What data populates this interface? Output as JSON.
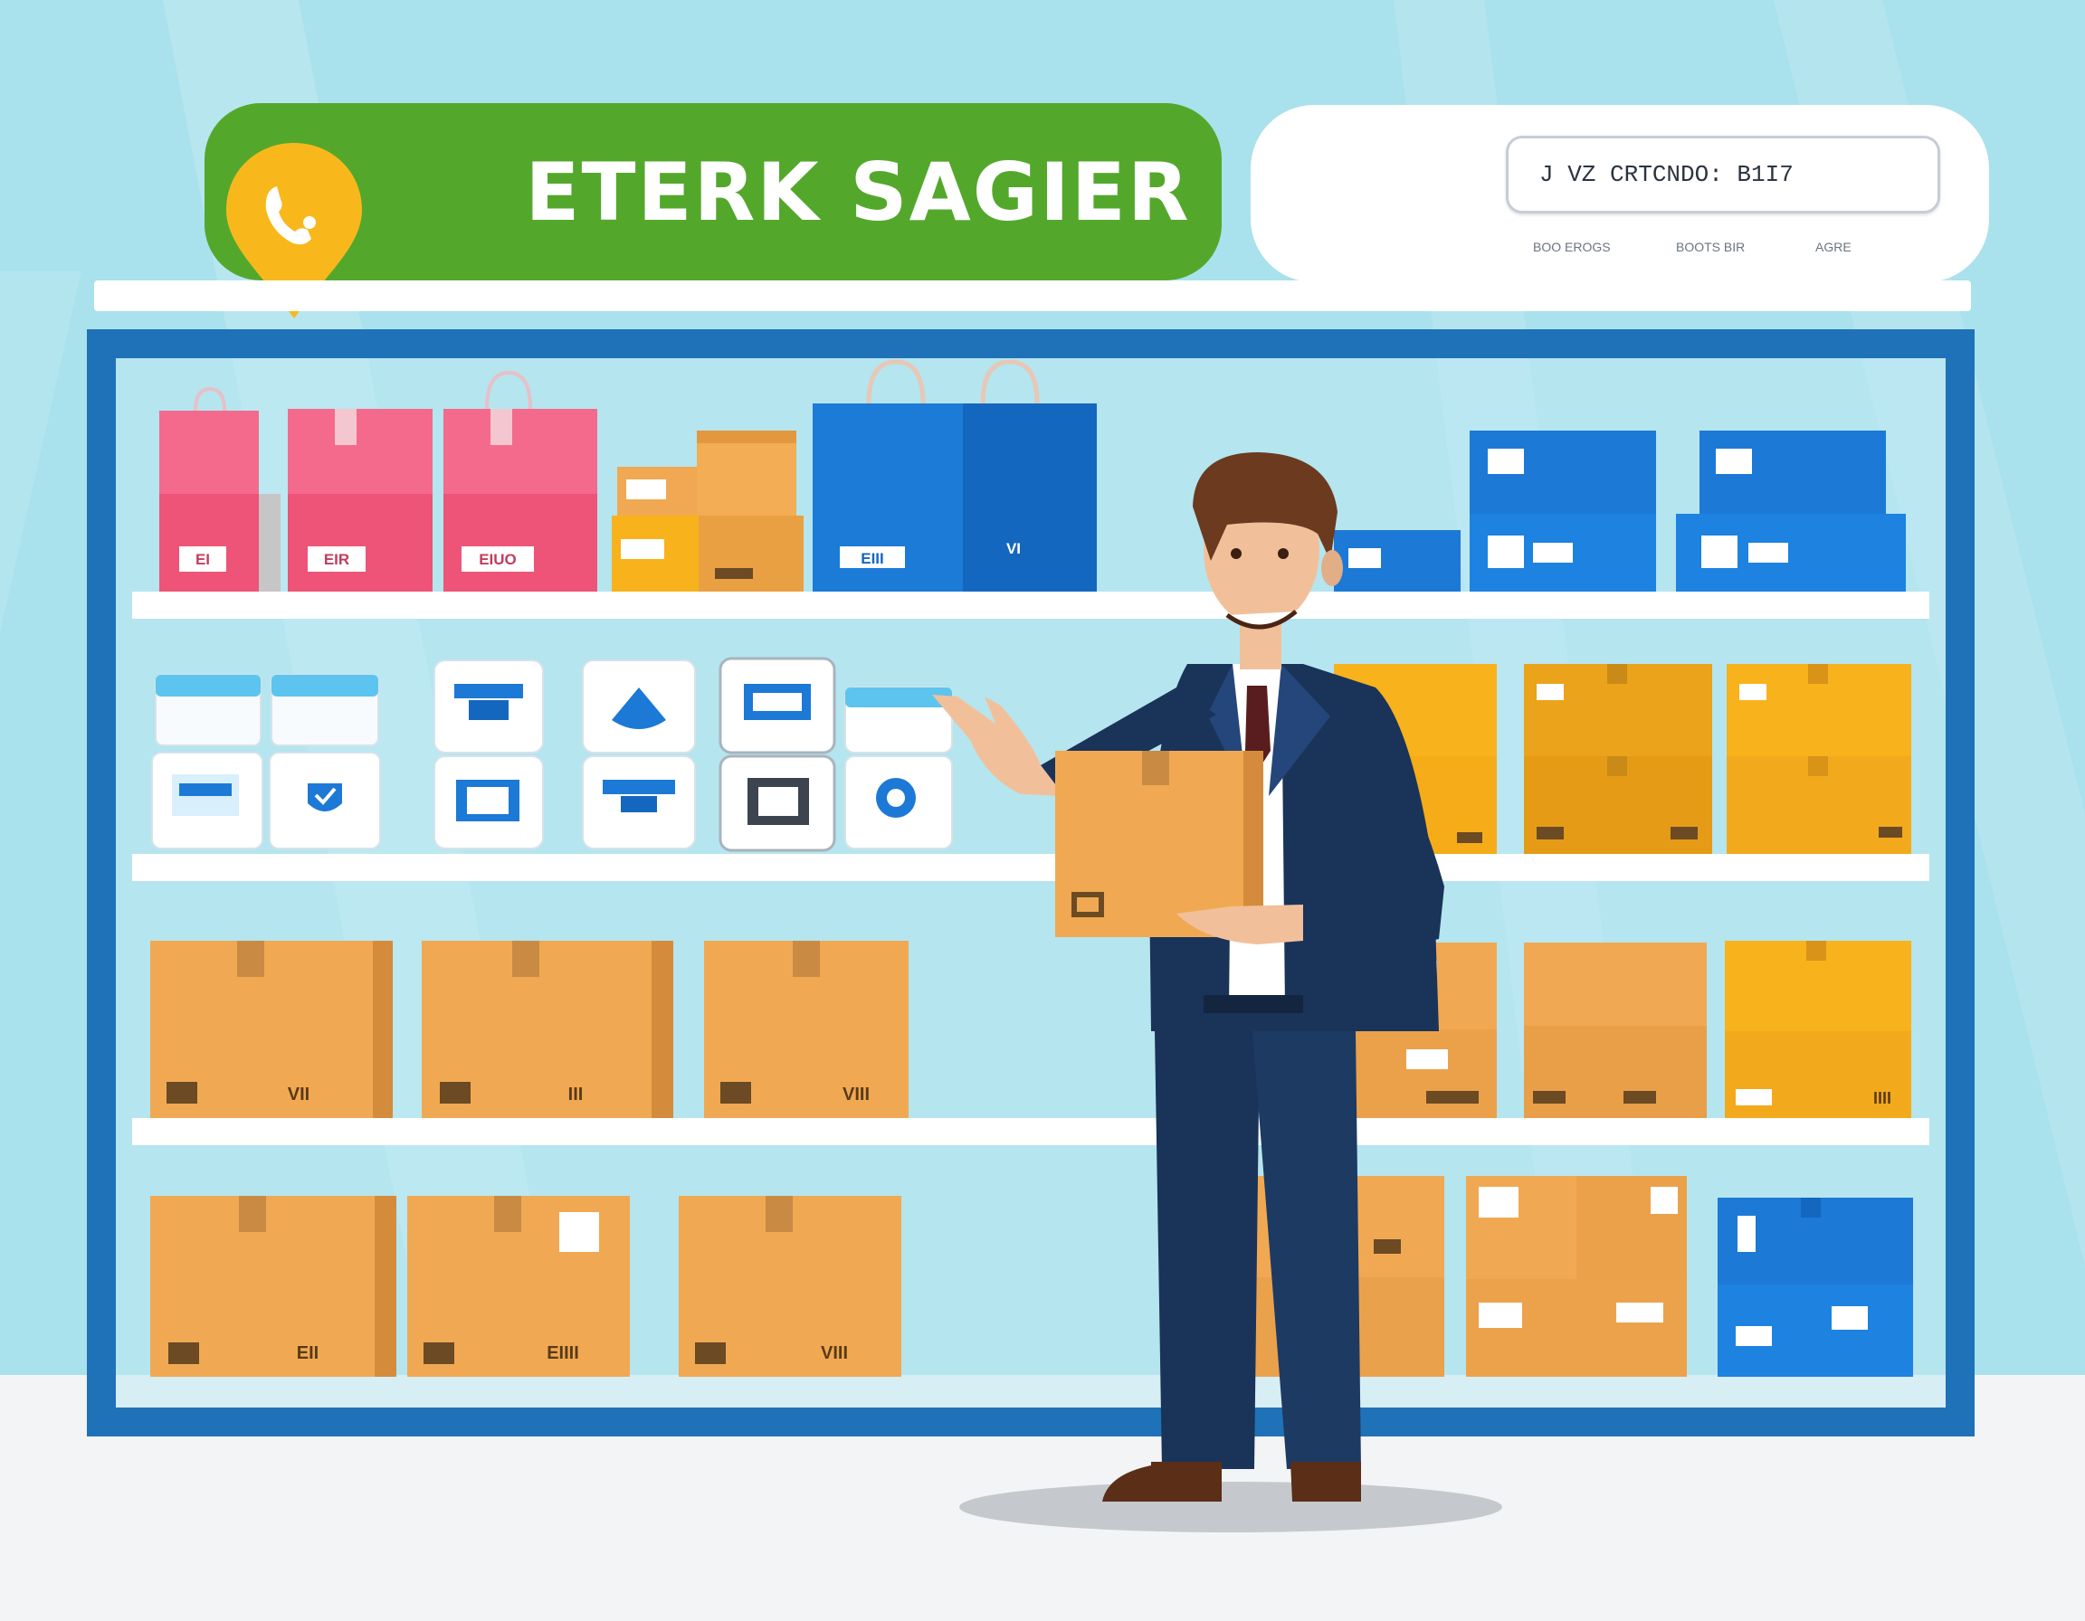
{
  "sign": {
    "title": "ETERK SAGIER",
    "pin_icon": "phone-icon"
  },
  "info_card": {
    "search_text": "J VZ CRTCNDO: B1I7",
    "meta": [
      "BOO EROGS",
      "BOOTS BIR",
      "AGRE"
    ]
  },
  "labels": {
    "pink_bags": [
      "EI",
      "EIR",
      "EIUO"
    ],
    "blue_bag": [
      "EIII",
      "VI"
    ],
    "row3_boxes": [
      "VII",
      "III",
      "VIII",
      "IIII"
    ],
    "row4_boxes": [
      "EII",
      "EIIII",
      "VIII"
    ]
  },
  "colors": {
    "sky": "#a9e1ec",
    "frame": "#1f72b8",
    "banner": "#53a82c",
    "pin": "#f8b81b",
    "cardboard": "#f0a952",
    "yellow_box": "#f7b21c",
    "blue_box": "#1c79d6",
    "pink_bag": "#ed5478",
    "suit": "#1a3359"
  }
}
